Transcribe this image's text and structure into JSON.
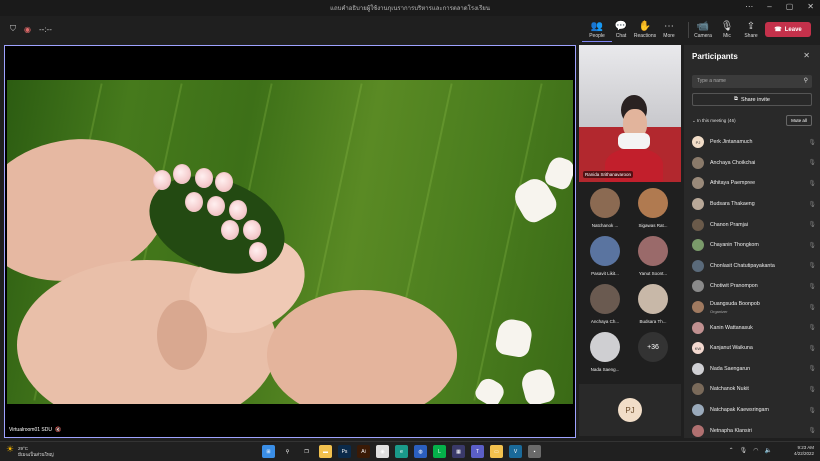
{
  "window": {
    "title": "แถบคำอธิบายผู้ใช้งานกุเนราการบริหารและการตลาดโรงเรียน"
  },
  "toolbar": {
    "timer": "--:--",
    "people": "People",
    "chat": "Chat",
    "reactions": "Reactions",
    "more": "More",
    "camera": "Camera",
    "mic": "Mic",
    "share": "Share",
    "leave": "Leave"
  },
  "stage": {
    "label": "Virtualroom01 SDU"
  },
  "tiles": {
    "featured": "Ranida Srithanavaroon",
    "mini": [
      {
        "label": "Natchanok ...",
        "color": "#8b6a52"
      },
      {
        "label": "Sigawas Rat...",
        "color": "#b07a50"
      },
      {
        "label": "Pasavit Likit...",
        "color": "#5a74a0"
      },
      {
        "label": "Yanut Soont...",
        "color": "#9a6a6a"
      },
      {
        "label": "Anchaya Ch...",
        "color": "#6a5a50"
      },
      {
        "label": "Budsara Th...",
        "color": "#c8b8a8"
      },
      {
        "label": "Nada Saeng...",
        "color": "#cfcfd2"
      },
      {
        "label": "",
        "count": "+36"
      }
    ],
    "self_initials": "PJ"
  },
  "panel": {
    "title": "Participants",
    "search_placeholder": "Type a name",
    "share_invite": "Share invite",
    "in_meeting": "In this meeting (46)",
    "mute_all": "Mute all",
    "participants": [
      {
        "name": "Perk Jintanamuch",
        "initials": "PJ",
        "color": "#f1ddc8"
      },
      {
        "name": "Anchaya Choikchai",
        "initials": "",
        "color": "#8a7a6a"
      },
      {
        "name": "Athitaya Paempree",
        "initials": "",
        "color": "#9a8a7a"
      },
      {
        "name": "Budsara Thakaeng",
        "initials": "",
        "color": "#b8a898"
      },
      {
        "name": "Chanon Pramjai",
        "initials": "",
        "color": "#6a5a4a"
      },
      {
        "name": "Chayanin Thongkom",
        "initials": "",
        "color": "#7a9a6a"
      },
      {
        "name": "Chonlasit Chatutipayakanta",
        "initials": "",
        "color": "#5a6a7a"
      },
      {
        "name": "Chotiwit Pranompon",
        "initials": "",
        "color": "#8a8a8a"
      },
      {
        "name": "Duangsuda Boonpob",
        "initials": "",
        "color": "#a07a60",
        "sub": "Organizer"
      },
      {
        "name": "Kanin Wattanasuk",
        "initials": "",
        "color": "#c09090"
      },
      {
        "name": "Kanjanut Waikuna",
        "initials": "KW",
        "color": "#f3d9d0"
      },
      {
        "name": "Nada Saengarun",
        "initials": "",
        "color": "#d0d0d4"
      },
      {
        "name": "Natchanok Nukit",
        "initials": "",
        "color": "#7a6a5a"
      },
      {
        "name": "Natchapak Kaewsringam",
        "initials": "",
        "color": "#9aaabb"
      },
      {
        "name": "Netnapha Klansiri",
        "initials": "",
        "color": "#b07070"
      }
    ]
  },
  "taskbar": {
    "temp": "29°C",
    "weather": "มีเมฆเป็นส่วนใหญ่",
    "time": "9:23 AM",
    "date": "4/22/2022",
    "apps": [
      {
        "name": "windows",
        "color": "#3a8ee6",
        "glyph": "⊞"
      },
      {
        "name": "search",
        "color": "#202020",
        "glyph": "⚲"
      },
      {
        "name": "taskview",
        "color": "#202020",
        "glyph": "❐"
      },
      {
        "name": "explorer",
        "color": "#f2c14e",
        "glyph": "▬"
      },
      {
        "name": "photoshop",
        "color": "#0b2a4a",
        "glyph": "Ps"
      },
      {
        "name": "illustrator",
        "color": "#3a1a06",
        "glyph": "Ai"
      },
      {
        "name": "chrome",
        "color": "#e0e0e0",
        "glyph": "◉"
      },
      {
        "name": "edge",
        "color": "#1a9a8a",
        "glyph": "e"
      },
      {
        "name": "browser",
        "color": "#2b5fbf",
        "glyph": "◍"
      },
      {
        "name": "line",
        "color": "#05b14a",
        "glyph": "L"
      },
      {
        "name": "store",
        "color": "#3a3a6a",
        "glyph": "▦"
      },
      {
        "name": "teams",
        "color": "#5b5fc7",
        "glyph": "T"
      },
      {
        "name": "files",
        "color": "#f2c14e",
        "glyph": "▭"
      },
      {
        "name": "vector",
        "color": "#1a6a9a",
        "glyph": "V"
      },
      {
        "name": "app",
        "color": "#6a6a6a",
        "glyph": "▪"
      }
    ]
  }
}
